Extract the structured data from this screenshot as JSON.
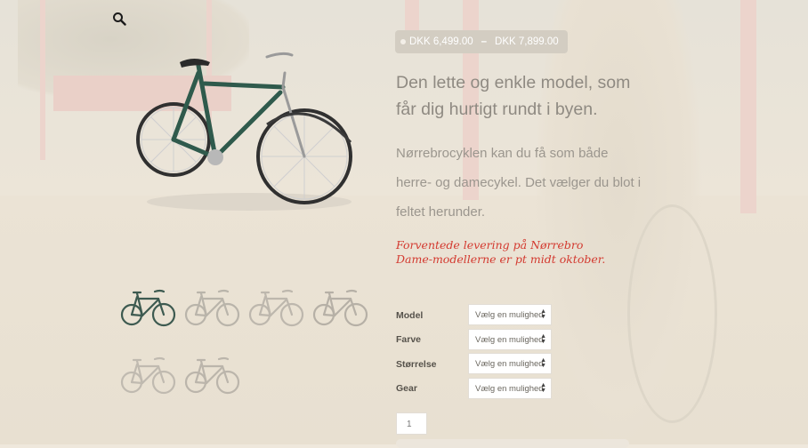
{
  "price": {
    "from": "DKK 6,499.00",
    "separator": "–",
    "to": "DKK 7,899.00"
  },
  "product": {
    "tagline": "Den lette og enkle model, som får dig hurtigt rundt i byen.",
    "description": "Nørrebrocyklen kan du få som både herre- og damecykel. Det vælger du blot i feltet herunder.",
    "notice": "Forventede levering på Nørrebro Dame-modellerne er pt midt oktober."
  },
  "options": [
    {
      "label": "Model",
      "value": "Vælg en mulighed"
    },
    {
      "label": "Farve",
      "value": "Vælg en mulighed"
    },
    {
      "label": "Størrelse",
      "value": "Vælg en mulighed"
    },
    {
      "label": "Gear",
      "value": "Vælg en mulighed"
    }
  ],
  "quantity": "1",
  "icons": {
    "zoom": "search-icon",
    "select_arrow": "updown-arrow-icon"
  },
  "colors": {
    "frame": "#2f5a4c",
    "notice": "#d33a30",
    "price_pill": "#d3cdc2"
  }
}
